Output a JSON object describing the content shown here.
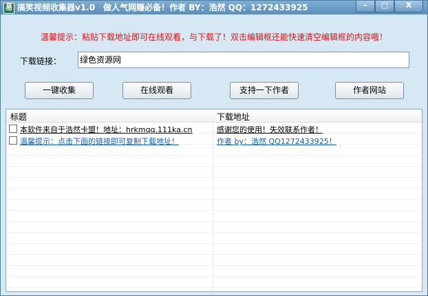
{
  "window": {
    "title": "搞笑视频收集器v1.0　做人气网赚必备！作者 BY：浩然 QQ：1272433925",
    "minimize": "–",
    "maximize": "□",
    "close": "X"
  },
  "tip": "温馨提示：粘贴下载地址即可在线观看，与下载了！双击编辑框还能快速清空编辑框的内容哦！",
  "link": {
    "label": "下载链接：",
    "value": "绿色资源网"
  },
  "buttons": [
    "一键收集",
    "在线观看",
    "支持一下作者",
    "作者网站"
  ],
  "list": {
    "columns": [
      "标题",
      "下载地址"
    ],
    "rows": [
      {
        "title": "本软件来自于浩然卡盟！地址：hrkmqq.111ka.cn",
        "url": "感谢您的使用！失效联系作者！",
        "checked": false
      },
      {
        "title": "温馨提示：点击下面的链接即可复制下载地址！",
        "url": "作者 by：浩然  QQ1272433925！",
        "checked": false
      }
    ]
  },
  "colors": {
    "tip": "#e01010",
    "link": "#1060c0"
  }
}
